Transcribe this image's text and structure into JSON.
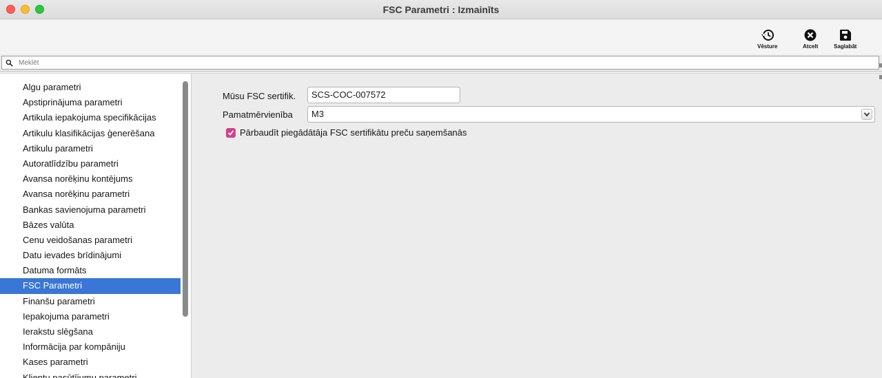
{
  "window": {
    "title": "FSC Parametri : Izmainīts"
  },
  "toolbar": {
    "history_label": "Vēsture",
    "cancel_label": "Atcelt",
    "save_label": "Saglabāt"
  },
  "search": {
    "placeholder": "Meklēt",
    "value": ""
  },
  "sidebar": {
    "items": [
      {
        "label": "Algu parametri"
      },
      {
        "label": "Apstiprinājuma parametri"
      },
      {
        "label": "Artikula iepakojuma specifikācijas"
      },
      {
        "label": "Artikulu klasifikācijas ģenerēšana"
      },
      {
        "label": "Artikulu parametri"
      },
      {
        "label": "Autoratlīdzību parametri"
      },
      {
        "label": "Avansa norēķinu kontējums"
      },
      {
        "label": "Avansa norēķinu parametri"
      },
      {
        "label": "Bankas savienojuma parametri"
      },
      {
        "label": "Bāzes valūta"
      },
      {
        "label": "Cenu veidošanas parametri"
      },
      {
        "label": "Datu ievades brīdinājumi"
      },
      {
        "label": "Datuma formāts"
      },
      {
        "label": "FSC Parametri",
        "selected": true
      },
      {
        "label": "Finanšu parametri"
      },
      {
        "label": "Iepakojuma parametri"
      },
      {
        "label": "Ierakstu slēgšana"
      },
      {
        "label": "Informācija par kompāniju"
      },
      {
        "label": "Kases parametri"
      },
      {
        "label": "Klientu pasūtījumu parametri"
      }
    ]
  },
  "form": {
    "cert_label": "Mūsu FSC sertifik.",
    "cert_value": "SCS-COC-007572",
    "unit_label": "Pamatmērvienība",
    "unit_value": "M3",
    "check_label": "Pārbaudīt piegādātāja FSC sertifikātu preču saņemšanās",
    "check_checked": true
  },
  "colors": {
    "selection": "#3a76d6",
    "checkbox": "#d6408b"
  }
}
